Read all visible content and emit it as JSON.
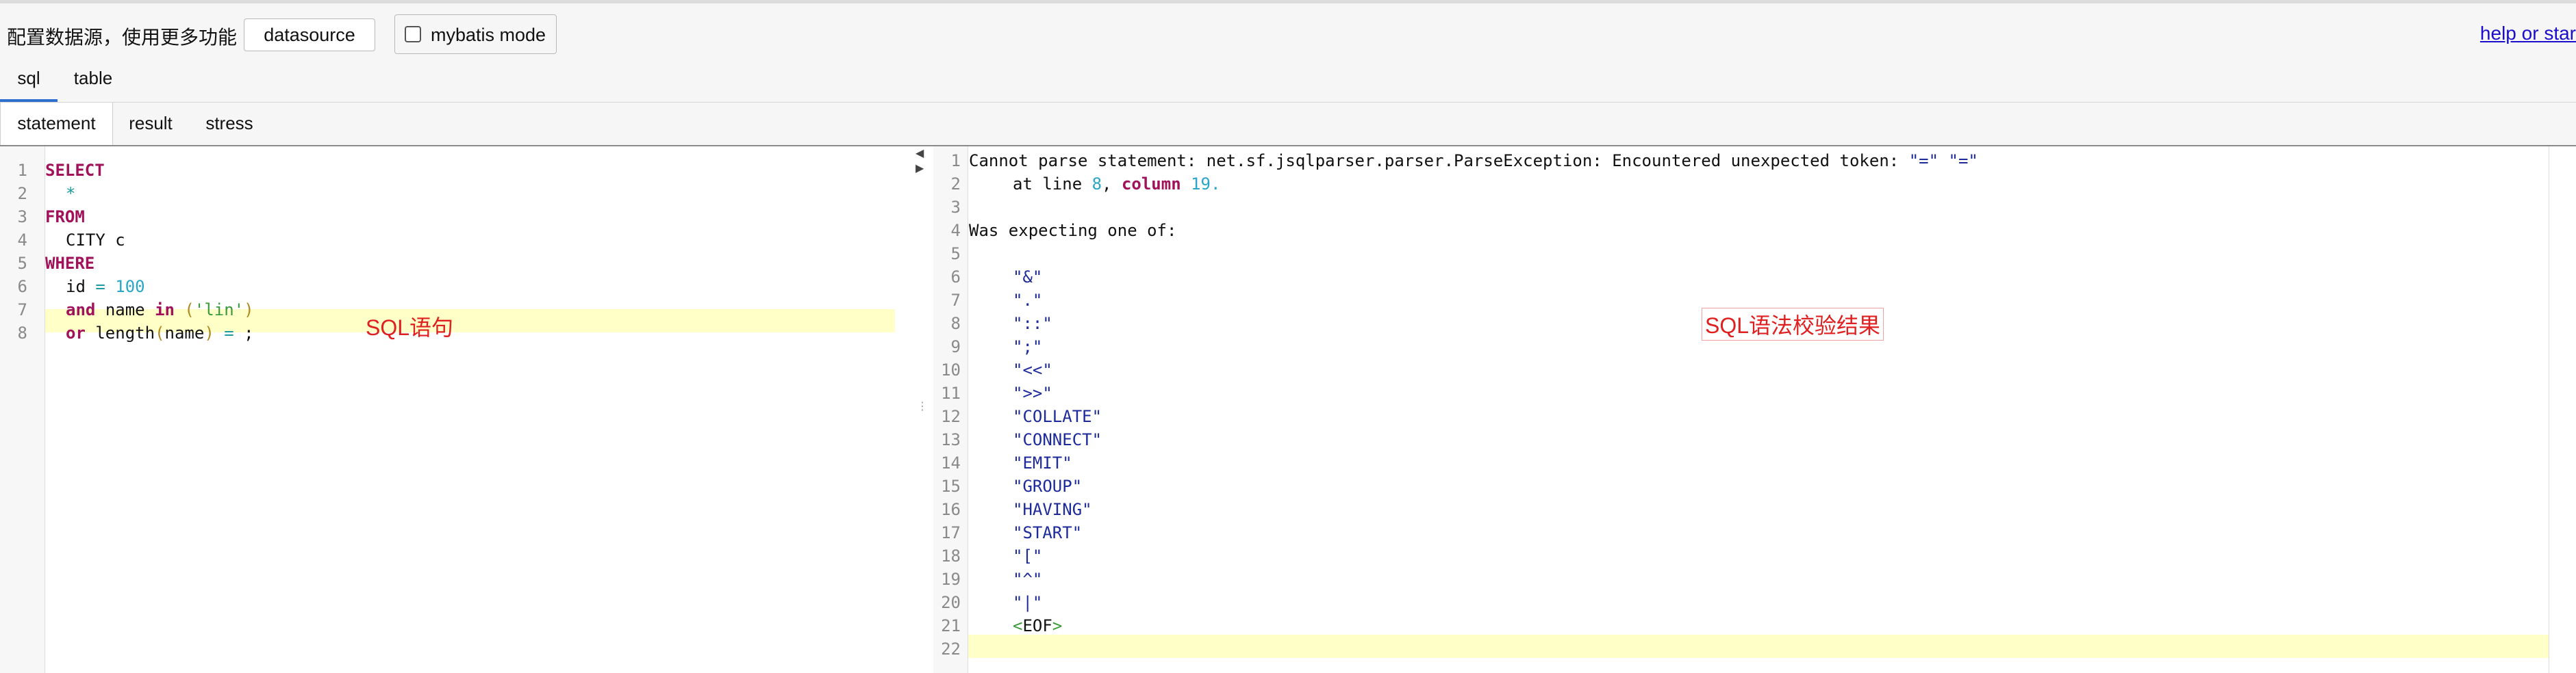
{
  "toolbar": {
    "config_text": "配置数据源，使用更多功能",
    "datasource_label": "datasource",
    "mybatis_label": "mybatis mode",
    "mybatis_checked": false,
    "help_link": "help or star"
  },
  "tabs_primary": [
    {
      "label": "sql",
      "active": true
    },
    {
      "label": "table",
      "active": false
    }
  ],
  "tabs_secondary": [
    {
      "label": "statement",
      "active": true
    },
    {
      "label": "result",
      "active": false
    },
    {
      "label": "stress",
      "active": false
    }
  ],
  "left_editor": {
    "line_numbers": [
      "1",
      "2",
      "3",
      "4",
      "5",
      "6",
      "7",
      "8"
    ],
    "annotation": "SQL语句",
    "highlighted_line": 8,
    "lines": {
      "l1": "SELECT",
      "l2": "*",
      "l3": "FROM",
      "l4": "CITY c",
      "l5": "WHERE",
      "l6_ident": "id",
      "l6_op": "=",
      "l6_num": "100",
      "l7_kw": "and",
      "l7_ident": "name",
      "l7_kw2": "in",
      "l7_open": "(",
      "l7_str": "'lin'",
      "l7_close": ")",
      "l8_kw": "or",
      "l8_fn": "length",
      "l8_open": "(",
      "l8_arg": "name",
      "l8_close": ")",
      "l8_op": "=",
      "l8_end": ";"
    }
  },
  "right_editor": {
    "line_numbers": [
      "1",
      "2",
      "3",
      "4",
      "5",
      "6",
      "7",
      "8",
      "9",
      "10",
      "11",
      "12",
      "13",
      "14",
      "15",
      "16",
      "17",
      "18",
      "19",
      "20",
      "21",
      "22"
    ],
    "annotation": "SQL语法校验结果",
    "highlighted_line": 22,
    "lines": {
      "l1_text": "Cannot parse statement: net.sf.jsqlparser.parser.ParseException: Encountered unexpected token: ",
      "l1_tok1": "\"=\"",
      "l1_tok2": "\"=\"",
      "l2_at": "at line ",
      "l2_num1": "8",
      "l2_comma": ", ",
      "l2_kw": "column",
      "l2_num2": "19.",
      "l4": "Was expecting one of:",
      "tokens": [
        "\"&\"",
        "\".\"",
        "\"::\"",
        "\";\"",
        "\"<<\"",
        "\">>\"",
        "\"COLLATE\"",
        "\"CONNECT\"",
        "\"EMIT\"",
        "\"GROUP\"",
        "\"HAVING\"",
        "\"START\"",
        "\"[\"",
        "\"^\"",
        "\"|\""
      ],
      "l21_lt": "<",
      "l21_eof": "EOF",
      "l21_gt": ">"
    }
  },
  "colors": {
    "keyword": "#a1125a",
    "number": "#2aa6c9",
    "string": "#3a9a3a",
    "token": "#1d2a9a",
    "highlight": "#ffffc8",
    "annotation": "#e02020",
    "link": "#1a0dcc",
    "active_tab": "#2f6fd0"
  }
}
